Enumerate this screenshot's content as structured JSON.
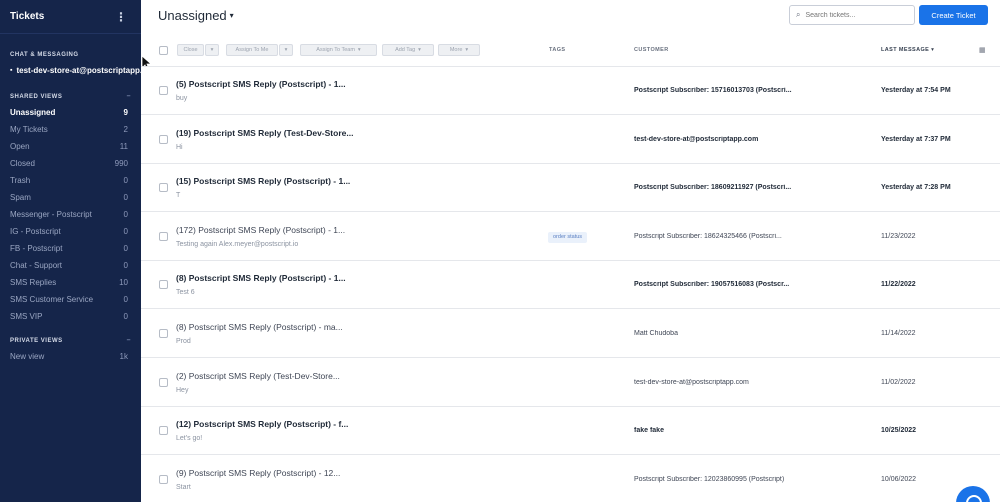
{
  "sidebar": {
    "title": "Tickets",
    "chat_section": "CHAT & MESSAGING",
    "chat_account": "test-dev-store-at@postscriptapp.com",
    "shared_section": "SHARED VIEWS",
    "shared_items": [
      {
        "label": "Unassigned",
        "count": "9",
        "active": true
      },
      {
        "label": "My Tickets",
        "count": "2"
      },
      {
        "label": "Open",
        "count": "11"
      },
      {
        "label": "Closed",
        "count": "990"
      },
      {
        "label": "Trash",
        "count": "0"
      },
      {
        "label": "Spam",
        "count": "0"
      },
      {
        "label": "Messenger - Postscript",
        "count": "0"
      },
      {
        "label": "IG - Postscript",
        "count": "0"
      },
      {
        "label": "FB - Postscript",
        "count": "0"
      },
      {
        "label": "Chat - Support",
        "count": "0"
      },
      {
        "label": "SMS Replies",
        "count": "10"
      },
      {
        "label": "SMS Customer Service",
        "count": "0"
      },
      {
        "label": "SMS VIP",
        "count": "0"
      }
    ],
    "private_section": "PRIVATE VIEWS",
    "private_items": [
      {
        "label": "New view",
        "count": "1k"
      }
    ]
  },
  "header": {
    "view_title": "Unassigned",
    "search_placeholder": "Search tickets...",
    "create_label": "Create Ticket"
  },
  "toolbar": {
    "close": "Close",
    "assign_me": "Assign To Me",
    "assign_team": "Assign To Team",
    "add_tag": "Add Tag",
    "more": "More"
  },
  "columns": {
    "tags": "TAGS",
    "customer": "CUSTOMER",
    "last_message": "LAST MESSAGE"
  },
  "tickets": [
    {
      "subject": "(5) Postscript SMS Reply (Postscript) - 1...",
      "preview": "buy",
      "tag": "",
      "customer": "Postscript Subscriber: 15716013703 (Postscri...",
      "time": "Yesterday at 7:54 PM",
      "unread": true
    },
    {
      "subject": "(19) Postscript SMS Reply (Test-Dev-Store...",
      "preview": "Hi",
      "tag": "",
      "customer": "test-dev-store-at@postscriptapp.com",
      "time": "Yesterday at 7:37 PM",
      "unread": true
    },
    {
      "subject": "(15) Postscript SMS Reply (Postscript) - 1...",
      "preview": "T",
      "tag": "",
      "customer": "Postscript Subscriber: 18609211927 (Postscri...",
      "time": "Yesterday at 7:28 PM",
      "unread": true
    },
    {
      "subject": "(172) Postscript SMS Reply (Postscript) - 1...",
      "preview": "Testing again Alex.meyer@postscript.io",
      "tag": "order status",
      "customer": "Postscript Subscriber: 18624325466 (Postscri...",
      "time": "11/23/2022",
      "unread": false
    },
    {
      "subject": "(8) Postscript SMS Reply (Postscript) - 1...",
      "preview": "Test 6",
      "tag": "",
      "customer": "Postscript Subscriber: 19057516083 (Postscr...",
      "time": "11/22/2022",
      "unread": true
    },
    {
      "subject": "(8) Postscript SMS Reply (Postscript) - ma...",
      "preview": "Prod",
      "tag": "",
      "customer": "Matt Chudoba",
      "time": "11/14/2022",
      "unread": false
    },
    {
      "subject": "(2) Postscript SMS Reply (Test-Dev-Store...",
      "preview": "Hey",
      "tag": "",
      "customer": "test-dev-store-at@postscriptapp.com",
      "time": "11/02/2022",
      "unread": false
    },
    {
      "subject": "(12) Postscript SMS Reply (Postscript) - f...",
      "preview": "Let's go!",
      "tag": "",
      "customer": "fake fake",
      "time": "10/25/2022",
      "unread": true
    },
    {
      "subject": "(9) Postscript SMS Reply (Postscript) - 12...",
      "preview": "Start",
      "tag": "",
      "customer": "Postscript Subscriber: 12023860995 (Postscript)",
      "time": "10/06/2022",
      "unread": false
    }
  ]
}
